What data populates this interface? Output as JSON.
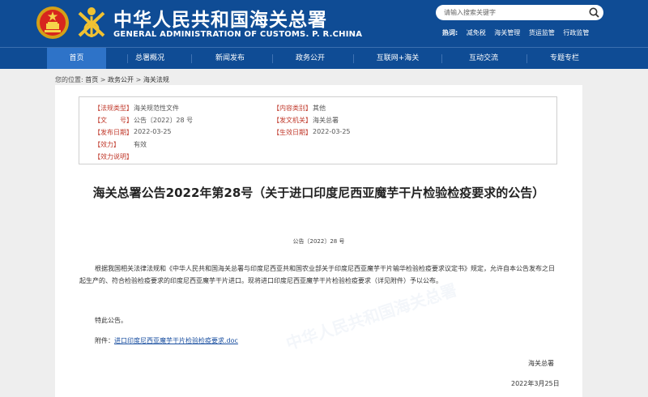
{
  "header": {
    "title_cn": "中华人民共和国海关总署",
    "title_en": "GENERAL ADMINISTRATION OF CUSTOMS. P. R.CHINA",
    "search_placeholder": "请输入搜索关键字",
    "hot_label": "热词:",
    "hot_links": [
      "减免税",
      "海关管理",
      "货运监管",
      "行政监管"
    ]
  },
  "nav": {
    "items": [
      "首页",
      "总署概况",
      "新闻发布",
      "政务公开",
      "互联网+海关",
      "互动交流",
      "专题专栏"
    ],
    "active_index": 0
  },
  "breadcrumb": {
    "prefix": "您的位置:",
    "items": [
      "首页",
      "政务公开",
      "海关法规"
    ],
    "separator": " > "
  },
  "meta": {
    "rows": [
      {
        "label": "【法规类型】",
        "value": "海关规范性文件",
        "label2": "【内容类别】",
        "value2": "其他"
      },
      {
        "label": "【文　　号】",
        "value": "公告〔2022〕28 号",
        "label2": "【发文机关】",
        "value2": "海关总署"
      },
      {
        "label": "【发布日期】",
        "value": "2022-03-25",
        "label2": "【生效日期】",
        "value2": "2022-03-25"
      },
      {
        "label": "【效力】",
        "value": "有效",
        "label2": "",
        "value2": ""
      },
      {
        "label": "【效力说明】",
        "value": "",
        "label2": "",
        "value2": ""
      }
    ]
  },
  "article": {
    "title": "海关总署公告2022年第28号（关于进口印度尼西亚魔芋干片检验检疫要求的公告）",
    "doc_number": "公告〔2022〕28 号",
    "paragraph1": "根据我国相关法律法规和《中华人民共和国海关总署与印度尼西亚共和国农业部关于印度尼西亚魔芋干片输华检验检疫要求议定书》规定，允许自本公告发布之日起生产的、符合检验检疫要求的印度尼西亚魔芋干片进口。现将进口印度尼西亚魔芋干片检验检疫要求（详见附件）予以公布。",
    "paragraph2": "特此公告。",
    "attachment_label": "附件：",
    "attachment_link": "进口印度尼西亚魔芋干片检验检疫要求.doc",
    "signature_org": "海关总署",
    "signature_date": "2022年3月25日"
  },
  "colors": {
    "header_bg": "#0f4c95",
    "nav_active": "#2e73c8",
    "meta_label": "#c0392b",
    "link": "#1a4fa0"
  }
}
